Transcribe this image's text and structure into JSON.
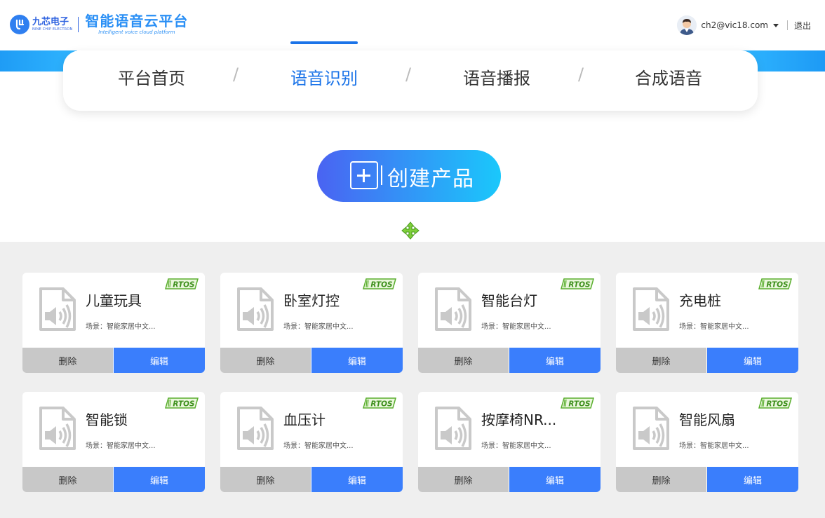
{
  "header": {
    "logo_cn": "九芯电子",
    "logo_en": "NINE CHIP ELECTRON",
    "platform_title": "智能语音云平台",
    "platform_subtitle": "Intelligent voice cloud platform",
    "user_email": "ch2@vic18.com",
    "logout_label": "退出"
  },
  "nav": {
    "tabs": [
      {
        "label": "平台首页",
        "active": false
      },
      {
        "label": "语音识别",
        "active": true
      },
      {
        "label": "语音播报",
        "active": false
      },
      {
        "label": "合成语音",
        "active": false
      }
    ],
    "separator": "/"
  },
  "create_button": {
    "label": "创建产品"
  },
  "colors": {
    "accent": "#1a73e8",
    "edit_button": "#3a7efc",
    "delete_button": "#c8c8c8",
    "background": "#efefef",
    "badge_green": "#6cbf3a"
  },
  "cards": [
    {
      "name": "儿童玩具",
      "scene": "场景：智能家居中文...",
      "badge": "RTOS",
      "delete_label": "删除",
      "edit_label": "编辑"
    },
    {
      "name": "卧室灯控",
      "scene": "场景：智能家居中文...",
      "badge": "RTOS",
      "delete_label": "删除",
      "edit_label": "编辑"
    },
    {
      "name": "智能台灯",
      "scene": "场景：智能家居中文...",
      "badge": "RTOS",
      "delete_label": "删除",
      "edit_label": "编辑"
    },
    {
      "name": "充电桩",
      "scene": "场景：智能家居中文...",
      "badge": "RTOS",
      "delete_label": "删除",
      "edit_label": "编辑"
    },
    {
      "name": "智能锁",
      "scene": "场景：智能家居中文...",
      "badge": "RTOS",
      "delete_label": "删除",
      "edit_label": "编辑"
    },
    {
      "name": "血压计",
      "scene": "场景：智能家居中文...",
      "badge": "RTOS",
      "delete_label": "删除",
      "edit_label": "编辑"
    },
    {
      "name": "按摩椅NR...",
      "scene": "场景：智能家居中文...",
      "badge": "RTOS",
      "delete_label": "删除",
      "edit_label": "编辑"
    },
    {
      "name": "智能风扇",
      "scene": "场景：智能家居中文...",
      "badge": "RTOS",
      "delete_label": "删除",
      "edit_label": "编辑"
    }
  ]
}
